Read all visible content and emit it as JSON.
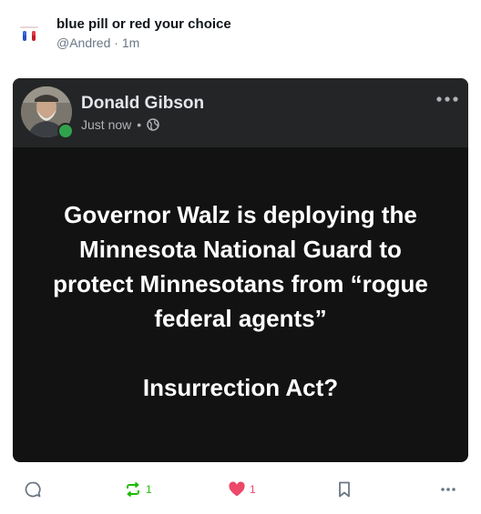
{
  "post": {
    "author_name": "blue pill or red your choice",
    "handle": "@Andred",
    "separator": "·",
    "time": "1m"
  },
  "embed": {
    "name": "Donald Gibson",
    "time": "Just now",
    "dot": "•",
    "body": "Governor Walz is deploying the\nMinnesota National Guard to\nprotect Minnesotans from “rogue\nfederal agents”\n\nInsurrection Act?"
  },
  "actions": {
    "reply_count": "",
    "repost_count": "1",
    "like_count": "1"
  },
  "colors": {
    "repost_active": "#20bc07",
    "like_active": "#ec4868",
    "icon_default": "#6b7785"
  },
  "icons": [
    "reply-icon",
    "repost-icon",
    "heart-icon",
    "bookmark-icon",
    "more-icon",
    "globe-icon",
    "pill-icon"
  ]
}
